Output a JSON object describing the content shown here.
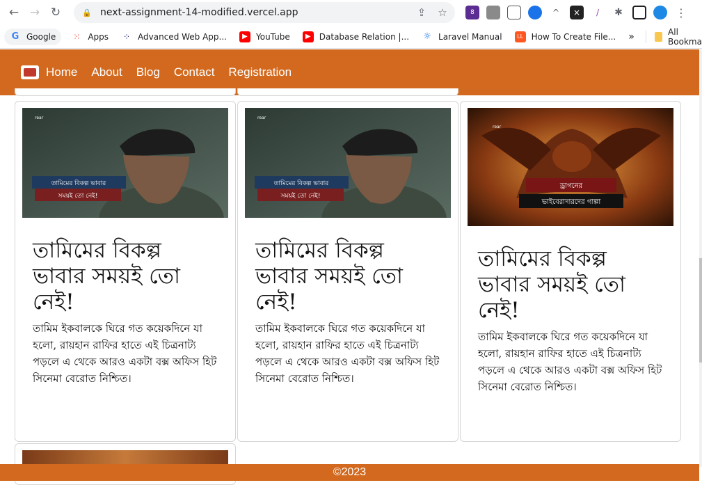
{
  "browser": {
    "url": "next-assignment-14-modified.vercel.app",
    "bookmarks": [
      "Google",
      "Apps",
      "Advanced Web App...",
      "YouTube",
      "Database Relation |...",
      "Laravel Manual",
      "How To Create File..."
    ],
    "all_bookmarks": "All Bookmarks",
    "overflow": "»",
    "ext_badge": "8"
  },
  "nav": {
    "links": [
      "Home",
      "About",
      "Blog",
      "Contact",
      "Registration"
    ]
  },
  "cards": [
    {
      "title": "তামিমের বিকল্প ভাবার সময়ই তো নেই!",
      "text": "তামিম ইকবালকে ঘিরে গত কয়েকদিনে যা হলো, রায়হান রাফির হাতে এই চিত্রনাট্য পড়লে এ থেকে আরও একটা বক্স অফিস হিট সিনেমা বেরোত নিশ্চিত।",
      "caption_1": "তামিমের বিকল্প ভাবার",
      "caption_2": "সময়ই তো নেই!",
      "brand": "rear"
    },
    {
      "title": "তামিমের বিকল্প ভাবার সময়ই তো নেই!",
      "text": "তামিম ইকবালকে ঘিরে গত কয়েকদিনে যা হলো, রায়হান রাফির হাতে এই চিত্রনাট্য পড়লে এ থেকে আরও একটা বক্স অফিস হিট সিনেমা বেরোত নিশ্চিত।",
      "caption_1": "তামিমের বিকল্প ভাবার",
      "caption_2": "সময়ই তো নেই!",
      "brand": "rear"
    },
    {
      "title": "তামিমের বিকল্প ভাবার সময়ই তো নেই!",
      "text": "তামিম ইকবালকে ঘিরে গত কয়েকদিনে যা হলো, রায়হান রাফির হাতে এই চিত্রনাট্য পড়লে এ থেকে আরও একটা বক্স অফিস হিট সিনেমা বেরোত নিশ্চিত।",
      "caption_1": "ড্রাগনের",
      "caption_2": "ভাইবেরাদারদের গাল্পা",
      "brand": "rear"
    }
  ],
  "footer": {
    "text": "©2023"
  }
}
